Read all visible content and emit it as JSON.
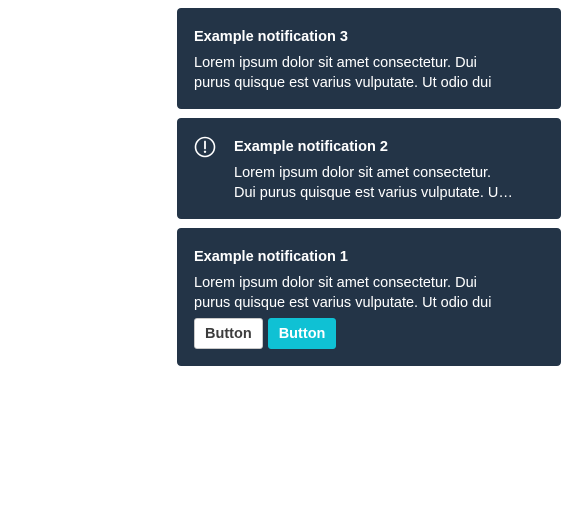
{
  "notifications": [
    {
      "title": "Example notification 3",
      "body": "Lorem ipsum dolor sit amet consectetur. Dui purus quisque est varius vulputate. Ut odio dui"
    },
    {
      "title": "Example notification 2",
      "body": "Lorem ipsum dolor sit amet consectetur. Dui purus quisque est varius vulputate. Ut odio dui",
      "icon": "alert-circle-icon"
    },
    {
      "title": "Example notification 1",
      "body": "Lorem ipsum dolor sit amet consectetur. Dui purus quisque est varius vulputate. Ut odio dui",
      "actions": {
        "secondary_label": "Button",
        "primary_label": "Button"
      }
    }
  ],
  "colors": {
    "toast_bg": "#233447",
    "primary_button": "#0fc1d4",
    "secondary_button": "#ffffff"
  }
}
